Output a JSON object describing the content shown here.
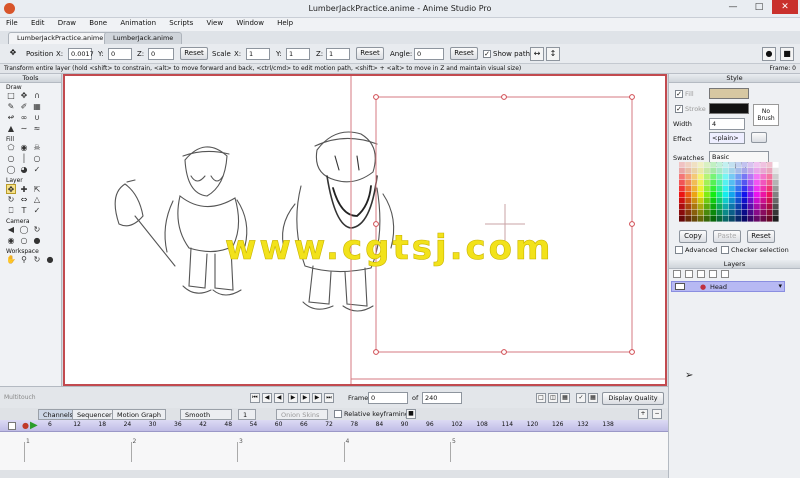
{
  "window": {
    "title": "LumberJackPractice.anime - Anime Studio Pro"
  },
  "menu": [
    "File",
    "Edit",
    "Draw",
    "Bone",
    "Animation",
    "Scripts",
    "View",
    "Window",
    "Help"
  ],
  "doc_tabs": [
    "LumberJackPractice.anime",
    "LumberJack.anime"
  ],
  "toolbar": {
    "position_label": "Position",
    "x_label": "X:",
    "x_value": "0.0017",
    "y_label": "Y:",
    "y_value": "0",
    "z_label": "Z:",
    "z_value": "0",
    "reset1": "Reset",
    "scale_label": "Scale",
    "sx_label": "X:",
    "sx_value": "1",
    "sy_label": "Y:",
    "sy_value": "1",
    "sz_label": "Z:",
    "sz_value": "1",
    "reset2": "Reset",
    "angle_label": "Angle:",
    "angle_value": "0",
    "reset3": "Reset",
    "show_path": "Show path"
  },
  "status": {
    "hint": "Transform entire layer (hold <shift> to constrain, <alt> to move forward and back, <ctrl/cmd> to edit motion path, <shift> + <alt> to move in Z and maintain visual size)",
    "frame": "Frame: 0"
  },
  "tools": {
    "title": "Tools",
    "sections": [
      "Draw",
      "Fill",
      "Layer",
      "Camera",
      "Workspace"
    ]
  },
  "watermark": "www.cgtsj.com",
  "style": {
    "title": "Style",
    "fill": "Fill",
    "stroke": "Stroke",
    "fill_color": "#d7c8a2",
    "stroke_color": "#111111",
    "no_brush": "No\nBrush",
    "width_label": "Width",
    "width_value": "4",
    "effect_label": "Effect",
    "effect_value": "<plain>",
    "swatches_label": "Swatches",
    "swatches_value": "Basic Colors.png",
    "copy": "Copy",
    "paste": "Paste",
    "reset": "Reset",
    "advanced": "Advanced",
    "checker": "Checker selection"
  },
  "layers": {
    "title": "Layers",
    "items": [
      "Head"
    ]
  },
  "transport": {
    "multitouch": "Multitouch",
    "frame_label": "Frame",
    "frame_value": "0",
    "of_label": "of",
    "total": "240",
    "display_quality": "Display Quality"
  },
  "timeline": {
    "tabs": [
      "Channels",
      "Sequencer",
      "Motion Graph"
    ],
    "interp": "Smooth",
    "interp_num": "1",
    "onion": "Onion Skins",
    "relative": "Relative keyframing",
    "ticks": [
      "6",
      "12",
      "18",
      "24",
      "30",
      "36",
      "42",
      "48",
      "54",
      "60",
      "66",
      "72",
      "78",
      "84",
      "90",
      "96",
      "102",
      "108",
      "114",
      "120",
      "126",
      "132",
      "138"
    ],
    "markers": [
      "1",
      "2",
      "3",
      "4",
      "5"
    ]
  }
}
